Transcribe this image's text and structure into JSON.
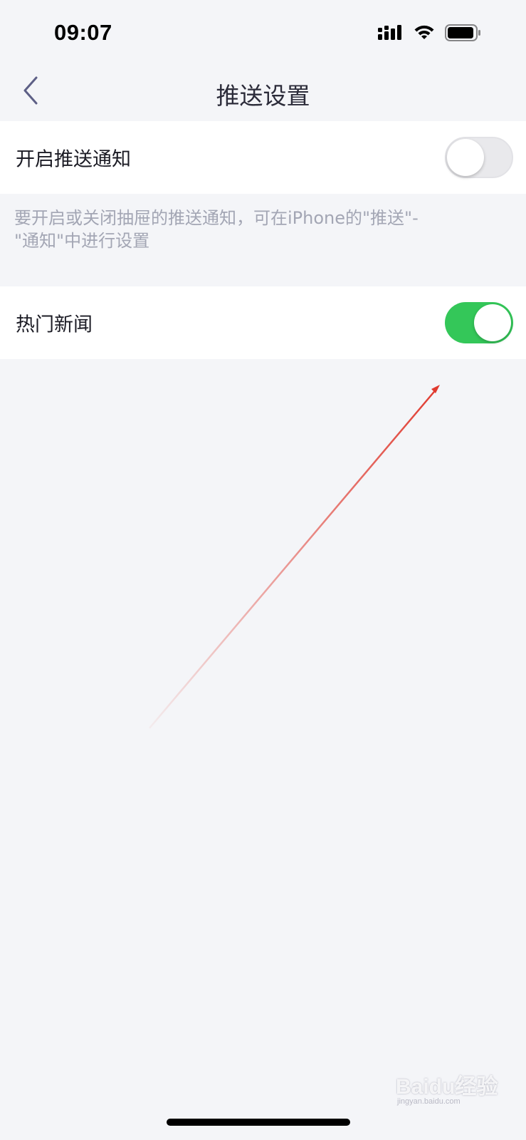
{
  "status_bar": {
    "time": "09:07",
    "signal_icon": "cellular-signal-icon",
    "wifi_icon": "wifi-icon",
    "battery_icon": "battery-icon"
  },
  "nav": {
    "back_icon": "chevron-left-icon",
    "title": "推送设置"
  },
  "settings": {
    "push_notifications": {
      "label": "开启推送通知",
      "enabled": false
    },
    "hint": "要开启或关闭抽屉的推送通知，可在iPhone的\"推送\"-\"通知\"中进行设置",
    "hot_news": {
      "label": "热门新闻",
      "enabled": true
    }
  },
  "colors": {
    "background": "#f4f5f8",
    "toggle_on": "#34c759",
    "toggle_off": "#e9e9ec",
    "hint_text": "#a3a6b4",
    "annotation_arrow": "#e03a2f"
  },
  "watermark": {
    "text": "Baidu经验",
    "sub": "jingyan.baidu.com"
  }
}
